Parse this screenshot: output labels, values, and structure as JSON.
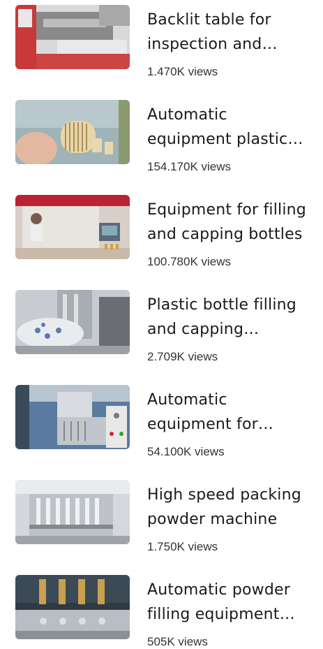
{
  "videos": [
    {
      "title": "Backlit table for inspection and sorting",
      "views": "1.470K views",
      "thumb": "backlit-table-thumbnail"
    },
    {
      "title": "Automatic equipment plastic parts",
      "views": "154.170K views",
      "thumb": "plastic-parts-thumbnail"
    },
    {
      "title": "Equipment for filling and capping bottles",
      "views": "100.780K views",
      "thumb": "filling-capping-thumbnail"
    },
    {
      "title": "Plastic bottle filling and capping machine",
      "views": "2.709K views",
      "thumb": "bottle-filling-thumbnail"
    },
    {
      "title": "Automatic equipment for packaging",
      "views": "54.100K views",
      "thumb": "automatic-equipment-thumbnail"
    },
    {
      "title": "High speed packing powder machine",
      "views": "1.750K views",
      "thumb": "powder-packing-thumbnail"
    },
    {
      "title": "Automatic powder filling equipment machine",
      "views": "505K views",
      "thumb": "powder-filling-thumbnail"
    }
  ]
}
